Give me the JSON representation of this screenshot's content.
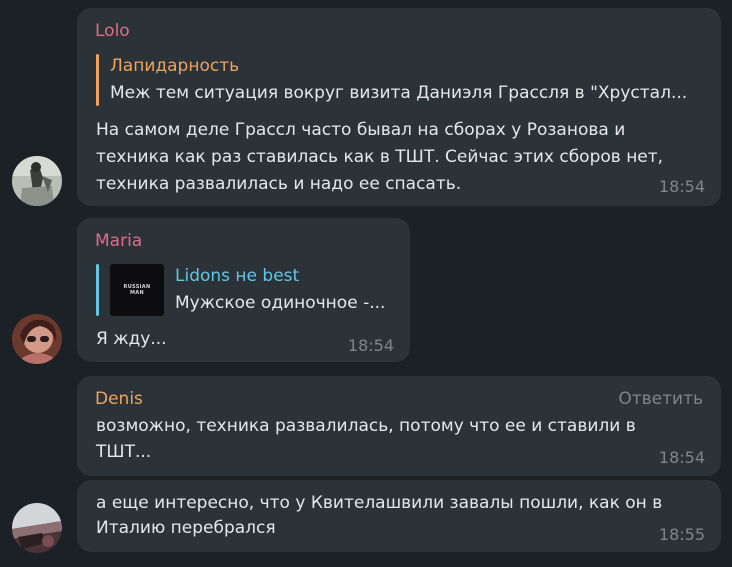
{
  "colors": {
    "background": "#1c2126",
    "bubble": "#2b3238",
    "lolo": "#e06c86",
    "maria": "#e06c86",
    "denis": "#f0a35a",
    "quote_lapidarnost": "#f0a35a",
    "quote_lidons": "#62c6e4"
  },
  "messages": [
    {
      "author": "Lolo",
      "quote": {
        "title": "Лапидарность",
        "text": "Меж тем ситуация вокруг визита Даниэля Грассля в \"Хрустал..."
      },
      "lines": [
        "На самом деле Грассл часто бывал на сборах у Розанова и",
        "техника как раз ставилась как в ТШТ. Сейчас этих сборов нет,",
        "техника развалилась и надо ее спасать."
      ],
      "time": "18:54"
    },
    {
      "author": "Maria",
      "quote": {
        "title": "Lidons не best",
        "text": "Мужское одиночное -...",
        "thumb_lines": [
          "RUSSIAN",
          "MAN"
        ]
      },
      "lines": [
        "Я жду..."
      ],
      "time": "18:54"
    },
    {
      "author": "Denis",
      "reply_label": "Ответить",
      "lines": [
        "возможно, техника развалилась, потому что ее и ставили в",
        "ТШТ..."
      ],
      "time": "18:54"
    },
    {
      "lines": [
        "а еще интересно, что у Квителашвили завалы пошли, как он в",
        "Италию перебрался"
      ],
      "time": "18:55"
    }
  ]
}
